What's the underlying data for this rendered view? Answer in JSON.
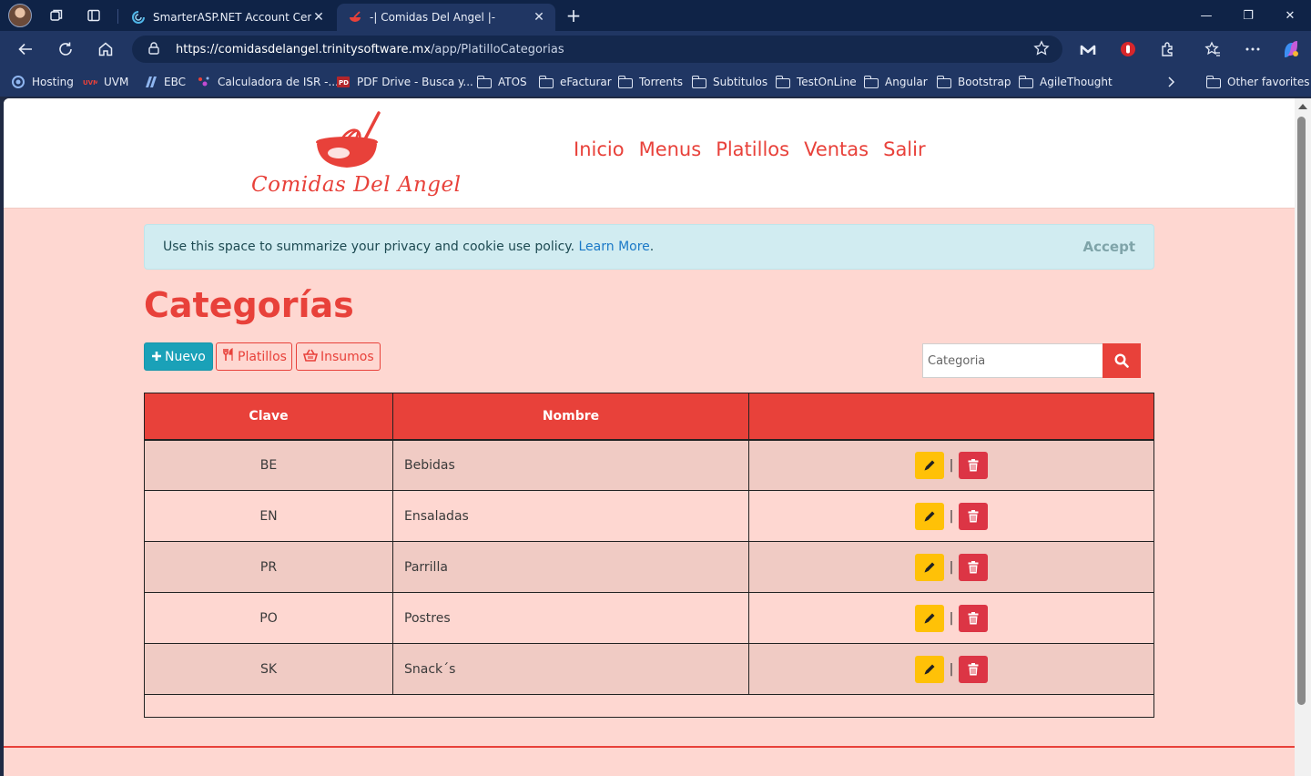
{
  "browser": {
    "tabs": [
      {
        "title": "SmarterASP.NET Account Center",
        "close": "✕",
        "active": false
      },
      {
        "title": "-| Comidas Del Angel |-",
        "close": "✕",
        "active": true
      }
    ],
    "new_tab": "+",
    "window_controls": {
      "minimize": "—",
      "restore": "❐",
      "close": "✕"
    },
    "url_base": "https://comidasdelangel.trinitysoftware.mx",
    "url_path": "/app/PlatilloCategorias",
    "bookmarks": [
      {
        "label": "Hosting",
        "icon": "hosting-icon"
      },
      {
        "label": "UVM",
        "icon": "uvm-icon"
      },
      {
        "label": "EBC",
        "icon": "ebc-icon"
      },
      {
        "label": "Calculadora de ISR -...",
        "icon": "calculadora-icon"
      },
      {
        "label": "PDF Drive - Busca y...",
        "icon": "pdf-drive-icon"
      },
      {
        "label": "ATOS",
        "icon": "folder-icon"
      },
      {
        "label": "eFacturar",
        "icon": "folder-icon"
      },
      {
        "label": "Torrents",
        "icon": "folder-icon"
      },
      {
        "label": "Subtitulos",
        "icon": "folder-icon"
      },
      {
        "label": "TestOnLine",
        "icon": "folder-icon"
      },
      {
        "label": "Angular",
        "icon": "folder-icon"
      },
      {
        "label": "Bootstrap",
        "icon": "folder-icon"
      },
      {
        "label": "AgileThought",
        "icon": "folder-icon"
      }
    ],
    "other_favorites": "Other favorites"
  },
  "site": {
    "logo_text": "Comidas Del Angel",
    "nav": [
      "Inicio",
      "Menus",
      "Platillos",
      "Ventas",
      "Salir"
    ],
    "brand_color": "#e8413a"
  },
  "cookie": {
    "message": "Use this space to summarize your privacy and cookie use policy.",
    "learn_more": "Learn More",
    "period": ".",
    "accept": "Accept"
  },
  "page": {
    "title": "Categorías",
    "buttons": {
      "nuevo": "Nuevo",
      "platillos": "Platillos",
      "insumos": "Insumos"
    },
    "search_placeholder": "Categoria"
  },
  "table": {
    "headers": [
      "Clave",
      "Nombre",
      ""
    ],
    "rows": [
      {
        "clave": "BE",
        "nombre": "Bebidas",
        "separator": "|"
      },
      {
        "clave": "EN",
        "nombre": "Ensaladas",
        "separator": "|"
      },
      {
        "clave": "PR",
        "nombre": "Parrilla",
        "separator": "|"
      },
      {
        "clave": "PO",
        "nombre": "Postres",
        "separator": "|"
      },
      {
        "clave": "SK",
        "nombre": "Snack´s",
        "separator": "|"
      }
    ]
  }
}
